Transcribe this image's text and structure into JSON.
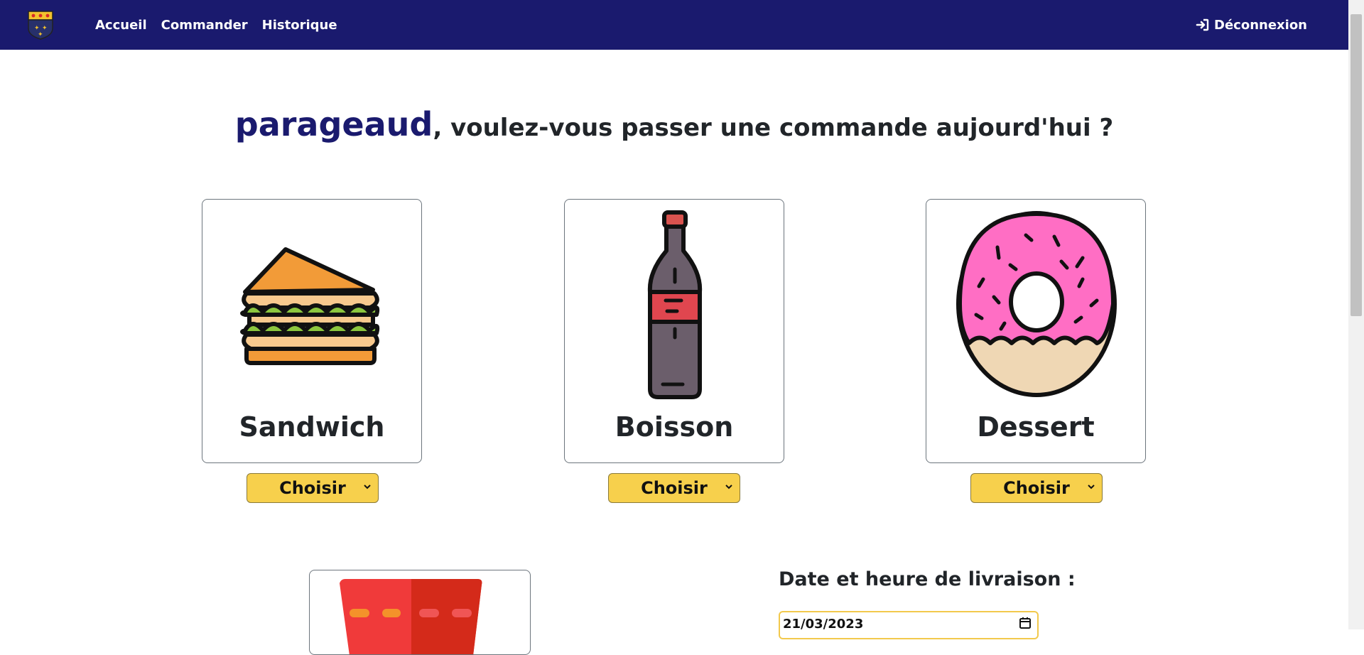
{
  "nav": {
    "links": [
      "Accueil",
      "Commander",
      "Historique"
    ],
    "logout_label": "Déconnexion"
  },
  "heading": {
    "username": "parageaud",
    "rest": ", voulez-vous passer une commande aujourd'hui ?"
  },
  "cards": [
    {
      "title": "Sandwich",
      "select_label": "Choisir",
      "icon": "sandwich-icon"
    },
    {
      "title": "Boisson",
      "select_label": "Choisir",
      "icon": "bottle-icon"
    },
    {
      "title": "Dessert",
      "select_label": "Choisir",
      "icon": "donut-icon"
    }
  ],
  "delivery": {
    "label": "Date et heure de livraison :",
    "value": "21/03/2023"
  },
  "colors": {
    "navbar": "#1a1a6e",
    "select": "#f7d04c",
    "username": "#1a1a6e"
  }
}
